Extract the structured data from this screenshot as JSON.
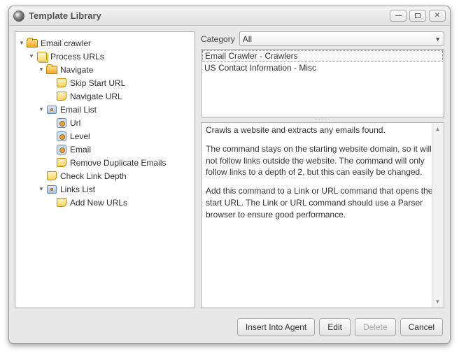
{
  "window": {
    "title": "Template Library"
  },
  "tree": {
    "root": "Email crawler",
    "process": "Process URLs",
    "navigate": "Navigate",
    "skipStart": "Skip Start URL",
    "navUrl": "Navigate URL",
    "emailList": "Email List",
    "url": "Url",
    "level": "Level",
    "email": "Email",
    "removeDup": "Remove Duplicate Emails",
    "checkDepth": "Check Link Depth",
    "linksList": "Links List",
    "addNew": "Add New URLs"
  },
  "category": {
    "label": "Category",
    "value": "All"
  },
  "templates": {
    "item1": "Email Crawler - Crawlers",
    "item2": "US Contact Information - Misc"
  },
  "description": {
    "p1": "Crawls a website and extracts any emails found.",
    "p2": "The command stays on the starting website domain, so it will not follow links outside the website. The command will only follow links to a depth of 2, but this can easily be changed.",
    "p3": "Add this command to a Link or URL command that opens the start URL. The Link or URL command should use a Parser browser to ensure good performance."
  },
  "buttons": {
    "insert": "Insert Into Agent",
    "edit": "Edit",
    "delete": "Delete",
    "cancel": "Cancel"
  }
}
